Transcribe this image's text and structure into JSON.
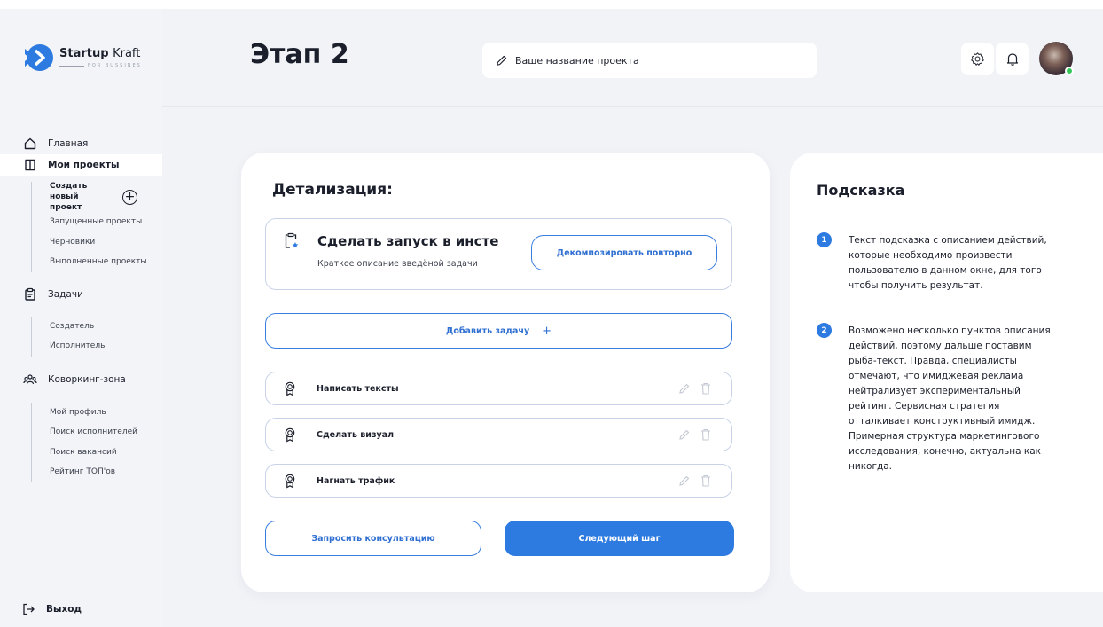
{
  "brand": {
    "name_bold": "Startup",
    "name_light": "Kraft",
    "tagline": "FOR BUSSINES"
  },
  "sidebar": {
    "home": "Главная",
    "my_projects": "Мои проекты",
    "create_project": "Создать новый проект",
    "projects_sub": [
      "Запущенные проекты",
      "Черновики",
      "Выполненные проекты"
    ],
    "tasks": "Задачи",
    "tasks_sub": [
      "Создатель",
      "Исполнитель"
    ],
    "coworking": "Коворкинг-зона",
    "coworking_sub": [
      "Мой профиль",
      "Поиск исполнителей",
      "Поиск вакансий",
      "Рейтинг ТОП'ов"
    ],
    "logout": "Выход"
  },
  "header": {
    "title": "Этап 2",
    "project_placeholder": "Ваше название проекта"
  },
  "detail": {
    "title": "Детализация:",
    "main_task": {
      "title": "Сделать запуск в инсте",
      "description": "Краткое описание введёной задачи",
      "decompose_button": "Декомпозировать повторно"
    },
    "add_task": "Добавить задачу",
    "tasks": [
      "Написать тексты",
      "Сделать визуал",
      "Нагнать трафик"
    ],
    "consult_button": "Запросить консультацию",
    "next_button": "Следующий шаг"
  },
  "hint": {
    "title": "Подсказка",
    "items": [
      {
        "num": "1",
        "text": "Текст подсказка с описанием действий, которые необходимо произвести пользователю в данном окне, для того чтобы получить результат."
      },
      {
        "num": "2",
        "text": "Возможено несколько пунктов описания действий, поэтому дальше поставим рыба-текст. Правда, специалисты отмечают, что имиджевая реклама нейтрализует экспериментальный рейтинг. Сервисная стратегия отталкивает конструктивный имидж. Примерная структура маркетингового исследования, конечно, актуальна как никогда."
      }
    ]
  },
  "colors": {
    "accent": "#2d7be0",
    "online": "#34c759",
    "background": "#f1f3f7"
  }
}
